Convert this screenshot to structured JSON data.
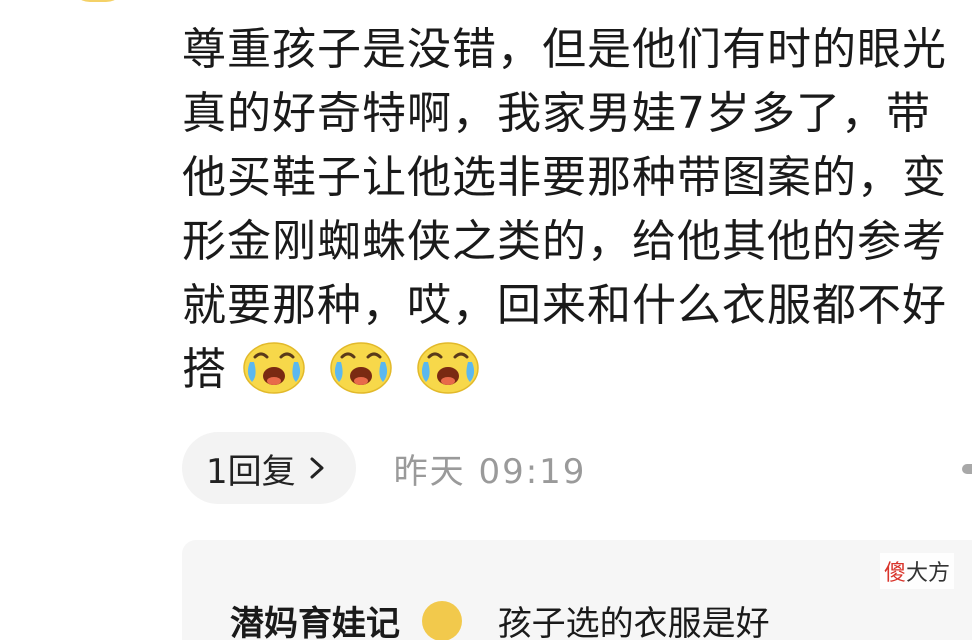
{
  "comment": {
    "lines": [
      "尊重孩子是没错，但是他们有时的眼光",
      "真的好奇特啊，我家男娃7岁多了，带",
      "他买鞋子让他选非要那种带图案的，变",
      "形金刚蜘蛛侠之类的，给他其他的参考",
      "就要那种，哎，回来和什么衣服都不好"
    ],
    "last_line_text": "搭",
    "emojis": [
      "crying-laughing-emoji",
      "crying-laughing-emoji",
      "crying-laughing-emoji"
    ]
  },
  "meta": {
    "reply_count_label": "1回复",
    "timestamp": "昨天  09:19"
  },
  "reply_preview": {
    "author": "潜妈育娃记",
    "text": "孩子选的衣服是好"
  },
  "watermark": {
    "accent": "傻",
    "rest": "大方"
  }
}
